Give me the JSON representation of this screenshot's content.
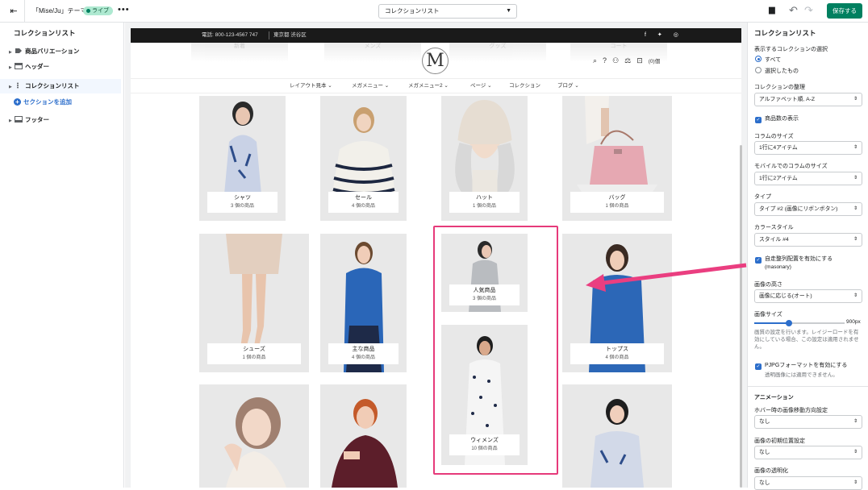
{
  "topbar": {
    "theme_name": "「Mise/Ju」テーマ",
    "live_badge": "ライブ",
    "more": "•••",
    "page_selector": "コレクションリスト",
    "save_label": "保存する"
  },
  "sidebar": {
    "title": "コレクションリスト",
    "items": [
      {
        "label": "商品バリエーション",
        "icon": "tag-icon"
      },
      {
        "label": "ヘッダー",
        "icon": "header-layout-icon"
      },
      {
        "label": "コレクションリスト",
        "icon": "drag-handle-icon"
      },
      {
        "label": "フッター",
        "icon": "footer-layout-icon"
      }
    ],
    "add_section": "セクションを追加"
  },
  "preview": {
    "announcement": {
      "phone": "電話: 800-123-4567 747",
      "location": "東京都 渋谷区",
      "social": "f ✦ ◎"
    },
    "header_ghosts": [
      "新着",
      "メンズ",
      "グッズ",
      "コート"
    ],
    "logo": "M",
    "cart_count": "(0)個",
    "nav": [
      "レイアウト見本 ⌄",
      "メガメニュー ⌄",
      "メガメニュー2 ⌄",
      "ページ ⌄",
      "コレクション",
      "ブログ ⌄"
    ],
    "collections": [
      {
        "title": "シャツ",
        "count": "3 個の商品"
      },
      {
        "title": "セール",
        "count": "4 個の商品"
      },
      {
        "title": "ハット",
        "count": "1 個の商品"
      },
      {
        "title": "バッグ",
        "count": "1 個の商品"
      },
      {
        "title": "シューズ",
        "count": "1 個の商品"
      },
      {
        "title": "主な商品",
        "count": "4 個の商品"
      },
      {
        "title": "人気商品",
        "count": "3 個の商品"
      },
      {
        "title": "ウィメンズ",
        "count": "10 個の商品"
      },
      {
        "title": "トップス",
        "count": "4 個の商品"
      }
    ]
  },
  "settings": {
    "title": "コレクションリスト",
    "select_label": "表示するコレクションの選択",
    "radio_all": "すべて",
    "radio_selected": "選択したもの",
    "sort_label": "コレクションの整理",
    "sort_value": "アルファベット順, A-Z",
    "show_count": "商品数の表示",
    "column_size_label": "コラムのサイズ",
    "column_size_value": "1行に4アイテム",
    "mobile_column_label": "モバイルでのコラムのサイズ",
    "mobile_column_value": "1行に2アイテム",
    "type_label": "タイプ",
    "type_value": "タイプ #2 (画像にリボンボタン)",
    "color_style_label": "カラースタイル",
    "color_style_value": "スタイル #4",
    "masonry_label": "自走整列配置を有効にする",
    "masonry_sub": "(masonary)",
    "image_height_label": "画像の高さ",
    "image_height_value": "画像に応じる(オート)",
    "image_size_label": "画像サイズ",
    "image_size_value": "900px",
    "image_size_fraction": 0.38,
    "image_size_help": "画質の設定を行います。レイジーロードを有効にしている場合、この設定は適用されません。",
    "pjpg_label": "PJPGフォーマットを有効にする",
    "pjpg_help": "透明画像には適用できません。",
    "animation_heading": "アニメーション",
    "hover_label": "ホバー時の画像移動方向設定",
    "hover_value": "なし",
    "initial_pos_label": "画像の初期位置設定",
    "initial_pos_value": "なし",
    "opacity_label": "画像の透明化",
    "opacity_value": "なし"
  },
  "colors": {
    "accent": "#2c6ecb",
    "save": "#008060",
    "highlight": "#e63a7a"
  }
}
